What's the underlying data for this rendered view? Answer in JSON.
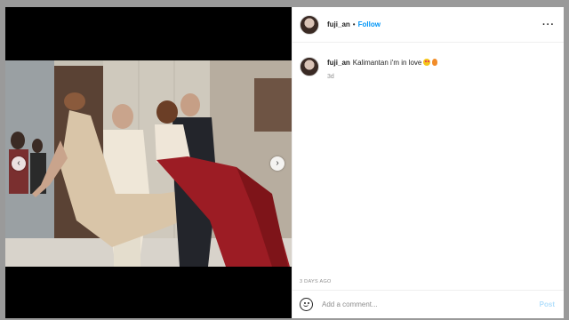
{
  "post": {
    "username": "fuji_an",
    "separator": "•",
    "follow_label": "Follow",
    "more_label": "···",
    "caption": "Kalimantan i'm in love",
    "caption_age": "3d",
    "date_label": "3 DAYS AGO"
  },
  "carousel": {
    "prev_arrow": "‹",
    "next_arrow": "›"
  },
  "comment_box": {
    "placeholder": "Add a comment...",
    "post_label": "Post"
  },
  "colors": {
    "accent": "#0095f6",
    "post_disabled": "#b2dffc",
    "text": "#262626",
    "secondary": "#8e8e8e"
  },
  "icons": {
    "avatar": "avatar",
    "more": "more-options-icon",
    "emoji": "emoji-icon",
    "prev": "chevron-left-icon",
    "next": "chevron-right-icon",
    "caption_emojis": [
      "heart-eyes-emoji",
      "fire-emoji"
    ]
  }
}
